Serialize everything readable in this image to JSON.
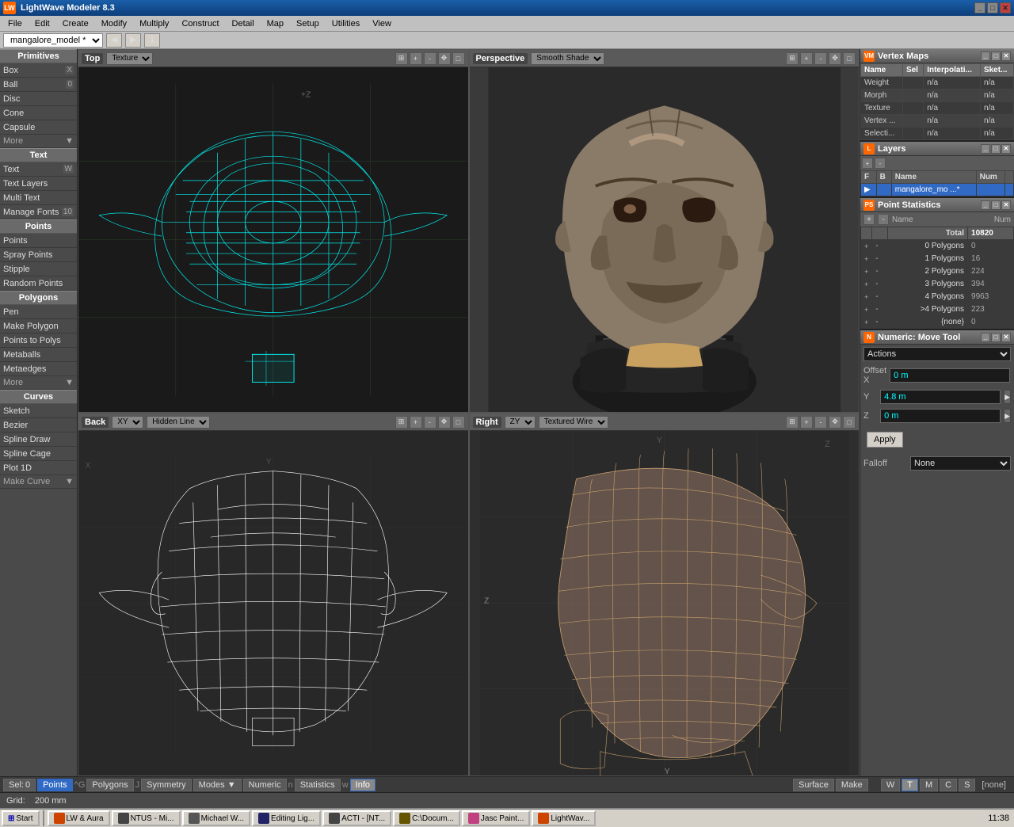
{
  "app": {
    "title": "LightWave Modeler 8.3",
    "model_name": "mangalore_model *"
  },
  "menubar": {
    "items": [
      "File",
      "Edit",
      "Create",
      "Modify",
      "Multiply",
      "Construct",
      "Detail",
      "Map",
      "Setup",
      "Utilities",
      "View"
    ]
  },
  "left_sidebar": {
    "sections": [
      {
        "name": "Primitives",
        "items": [
          {
            "label": "Box",
            "shortcut": "X"
          },
          {
            "label": "Ball",
            "shortcut": "0"
          },
          {
            "label": "Disc",
            "shortcut": ""
          },
          {
            "label": "Cone",
            "shortcut": ""
          },
          {
            "label": "Capsule",
            "shortcut": ""
          },
          {
            "label": "More",
            "more": true
          }
        ]
      },
      {
        "name": "Text",
        "items": [
          {
            "label": "Text",
            "shortcut": "W"
          },
          {
            "label": "Text Layers",
            "shortcut": ""
          },
          {
            "label": "Multi Text",
            "shortcut": ""
          },
          {
            "label": "Manage Fonts",
            "shortcut": "10"
          }
        ]
      },
      {
        "name": "Points",
        "items": [
          {
            "label": "Points",
            "shortcut": ""
          },
          {
            "label": "Spray Points",
            "shortcut": ""
          },
          {
            "label": "Stipple",
            "shortcut": ""
          },
          {
            "label": "Random Points",
            "shortcut": ""
          }
        ]
      },
      {
        "name": "Polygons",
        "items": [
          {
            "label": "Pen",
            "shortcut": ""
          },
          {
            "label": "Make Polygon",
            "shortcut": ""
          },
          {
            "label": "Points to Polys",
            "shortcut": ""
          },
          {
            "label": "Metaballs",
            "shortcut": ""
          },
          {
            "label": "Metaedges",
            "shortcut": ""
          },
          {
            "label": "More",
            "more": true
          }
        ]
      },
      {
        "name": "Curves",
        "items": [
          {
            "label": "Sketch",
            "shortcut": ""
          },
          {
            "label": "Bezier",
            "shortcut": ""
          },
          {
            "label": "Spline Draw",
            "shortcut": ""
          },
          {
            "label": "Spline Cage",
            "shortcut": ""
          },
          {
            "label": "Plot 1D",
            "shortcut": ""
          },
          {
            "label": "Make Curve",
            "more": true
          }
        ]
      }
    ]
  },
  "viewports": [
    {
      "id": "top-left",
      "label": "Top",
      "mode": "Texture",
      "type": "wireframe-cyan",
      "axis_label": "+Z"
    },
    {
      "id": "top-right",
      "label": "Perspective",
      "mode": "Smooth Shade",
      "type": "shaded"
    },
    {
      "id": "bottom-left",
      "label": "Back",
      "mode": "Hidden Line",
      "axis_label": "XY",
      "type": "wireframe-white"
    },
    {
      "id": "bottom-right",
      "label": "Right",
      "mode": "Textured Wire",
      "axis_label": "ZY",
      "type": "wireframe-warm"
    }
  ],
  "vertex_maps": {
    "title": "Vertex Maps",
    "columns": [
      "Name",
      "Sel",
      "Interpolati...",
      "Sket..."
    ],
    "rows": [
      {
        "name": "Weight",
        "sel": "",
        "interp": "n/a",
        "sket": "n/a"
      },
      {
        "name": "Morph",
        "sel": "",
        "interp": "n/a",
        "sket": "n/a"
      },
      {
        "name": "Texture",
        "sel": "",
        "interp": "n/a",
        "sket": "n/a"
      },
      {
        "name": "Vertex ...",
        "sel": "",
        "interp": "n/a",
        "sket": "n/a"
      },
      {
        "name": "Selecti...",
        "sel": "",
        "interp": "n/a",
        "sket": "n/a"
      }
    ]
  },
  "layers": {
    "title": "Layers",
    "columns": [
      "F",
      "B",
      "Name",
      "Num",
      ""
    ],
    "rows": [
      {
        "f": "",
        "b": "",
        "name": "mangalore_mo ...*",
        "num": "",
        "active": true
      }
    ]
  },
  "point_stats": {
    "title": "Point Statistics",
    "columns": [
      "+",
      "-",
      "Name",
      "Num"
    ],
    "rows": [
      {
        "type": "total",
        "plus": "",
        "minus": "",
        "name": "Total",
        "num": "10820"
      },
      {
        "type": "sub",
        "plus": "+",
        "minus": "",
        "name": "0 Polygons",
        "num": "0"
      },
      {
        "type": "sub",
        "plus": "+",
        "minus": "",
        "name": "1 Polygons",
        "num": "16"
      },
      {
        "type": "sub",
        "plus": "+",
        "minus": "",
        "name": "2 Polygons",
        "num": "224"
      },
      {
        "type": "sub",
        "plus": "+",
        "minus": "",
        "name": "3 Polygons",
        "num": "394"
      },
      {
        "type": "sub",
        "plus": "+",
        "minus": "",
        "name": "4 Polygons",
        "num": "9963"
      },
      {
        "type": "sub",
        "plus": "+",
        "minus": "",
        "name": ">4 Polygons",
        "num": "223"
      },
      {
        "type": "sub",
        "plus": "+",
        "minus": "",
        "name": "{none}",
        "num": "0"
      }
    ]
  },
  "numeric_tool": {
    "title": "Numeric: Move Tool",
    "actions_label": "Actions",
    "offset_x_label": "Offset X",
    "offset_x_value": "0 m",
    "y_label": "Y",
    "y_value": "4.8 m",
    "z_label": "Z",
    "z_value": "0 m",
    "apply_label": "Apply",
    "falloff_label": "Falloff",
    "falloff_value": "None"
  },
  "statusbar": {
    "sel_label": "Sel:",
    "sel_value": "0",
    "grid_label": "Grid:",
    "grid_value": "200 mm",
    "tabs": [
      "Points",
      "G",
      "Polygons",
      "J",
      "Symmetry",
      "Modes",
      "Numeric",
      "n",
      "Statistics",
      "w",
      "Info"
    ],
    "surface_label": "Surface",
    "make_label": "Make",
    "mode_btns": [
      "W",
      "T",
      "M",
      "C",
      "S"
    ],
    "none_label": "[none]"
  },
  "taskbar": {
    "items": [
      "Start",
      "LW & Aura",
      "NTUS - Mi...",
      "Michael W...",
      "Editing Lig...",
      "ACTI - [NT...",
      "C:\\Docum...",
      "Jasc Paint...",
      "LightWav..."
    ],
    "time": "11:38"
  }
}
